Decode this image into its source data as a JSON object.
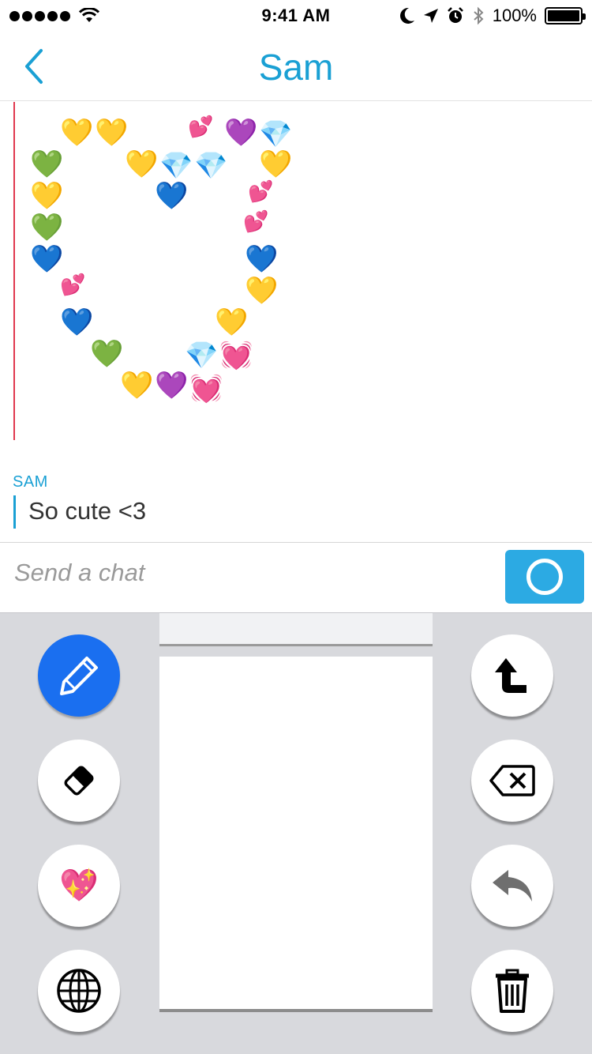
{
  "status_bar": {
    "time": "9:41 AM",
    "battery": "100%",
    "signal_dots": 5,
    "icons": [
      "wifi-icon",
      "moon-icon",
      "location-arrow-icon",
      "alarm-icon",
      "bluetooth-icon",
      "battery-icon"
    ]
  },
  "nav": {
    "title": "Sam",
    "back_icon": "chevron-left-icon"
  },
  "conversation": {
    "drawing_emojis": [
      {
        "glyph": "💛"
      },
      {
        "glyph": "💛"
      },
      {
        "glyph": "💕"
      },
      {
        "glyph": "💜"
      },
      {
        "glyph": "💎"
      },
      {
        "glyph": "💚"
      },
      {
        "glyph": "💛"
      },
      {
        "glyph": "💎"
      },
      {
        "glyph": "💎"
      },
      {
        "glyph": "💛"
      },
      {
        "glyph": "💛"
      },
      {
        "glyph": "💙"
      },
      {
        "glyph": "💕"
      },
      {
        "glyph": "💚"
      },
      {
        "glyph": "💕"
      },
      {
        "glyph": "💙"
      },
      {
        "glyph": "💙"
      },
      {
        "glyph": "💕"
      },
      {
        "glyph": "💛"
      },
      {
        "glyph": "💙"
      },
      {
        "glyph": "💛"
      },
      {
        "glyph": "💚"
      },
      {
        "glyph": "💎"
      },
      {
        "glyph": "💓"
      },
      {
        "glyph": "💛"
      },
      {
        "glyph": "💜"
      },
      {
        "glyph": "💓"
      }
    ],
    "message": {
      "sender": "SAM",
      "text": "So cute <3"
    }
  },
  "input": {
    "placeholder": "Send a chat",
    "send_icon": "circle-icon"
  },
  "keyboard": {
    "left_tools": [
      {
        "name": "pencil",
        "icon": "pencil-icon",
        "active": true
      },
      {
        "name": "eraser",
        "icon": "eraser-icon",
        "active": false
      },
      {
        "name": "emoji",
        "icon": "sparkling-heart-icon",
        "glyph": "💖",
        "active": false
      },
      {
        "name": "globe",
        "icon": "globe-icon",
        "active": false
      }
    ],
    "right_tools": [
      {
        "name": "shift",
        "icon": "shift-arrow-icon"
      },
      {
        "name": "backspace",
        "icon": "backspace-icon"
      },
      {
        "name": "undo",
        "icon": "undo-icon"
      },
      {
        "name": "trash",
        "icon": "trash-icon"
      }
    ],
    "colors": {
      "active_tool": "#1a6ff0",
      "accent": "#1aa0d4",
      "send": "#2caae3",
      "divider": "#e0394f"
    }
  }
}
